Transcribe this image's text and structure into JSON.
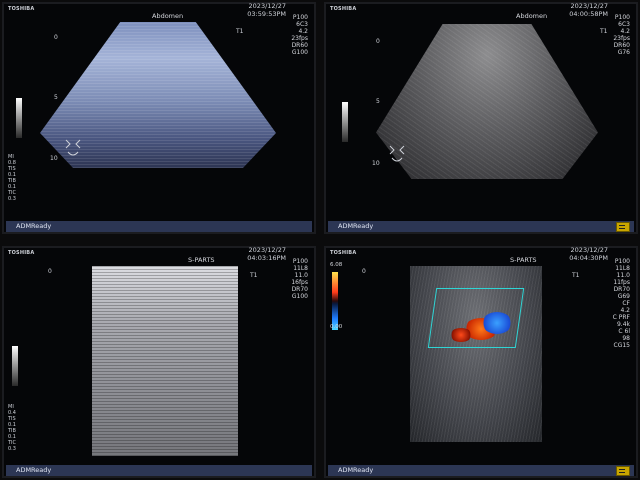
{
  "panels": [
    {
      "brand": "TOSHIBA",
      "date": "2023/12/27",
      "time": "03:59:53PM",
      "application": "Abdomen",
      "params": [
        "P100",
        "6C3",
        "4.2",
        "23fps",
        "DR60",
        "G100"
      ],
      "depth_top": "0",
      "depth_mid": "5",
      "depth_bottom": "10",
      "stats": [
        "MI",
        "0.8",
        "TIS",
        "0.1",
        "TIB",
        "0.1",
        "TIC",
        "0.3"
      ],
      "status": "ADMReady",
      "probe_mark": "T1"
    },
    {
      "brand": "TOSHIBA",
      "date": "2023/12/27",
      "time": "04:00:58PM",
      "application": "Abdomen",
      "params": [
        "P100",
        "6C3",
        "4.2",
        "23fps",
        "DR60",
        "G76"
      ],
      "depth_top": "0",
      "depth_mid": "5",
      "depth_bottom": "10",
      "status": "ADMReady",
      "probe_mark": "T1"
    },
    {
      "brand": "TOSHIBA",
      "date": "2023/12/27",
      "time": "04:03:16PM",
      "application": "S-PARTS",
      "params": [
        "P100",
        "11L8",
        "11.0",
        "16fps",
        "DR70",
        "G100"
      ],
      "depth_top": "0",
      "stats": [
        "MI",
        "0.4",
        "TIS",
        "0.1",
        "TIB",
        "0.1",
        "TIC",
        "0.3"
      ],
      "status": "ADMReady",
      "probe_mark": "T1"
    },
    {
      "brand": "TOSHIBA",
      "date": "2023/12/27",
      "time": "04:04:30PM",
      "application": "S-PARTS",
      "params": [
        "P100",
        "11L8",
        "11.0",
        "11fps",
        "DR70",
        "G69",
        "CF",
        "4.2",
        "C PRF",
        "9.4k",
        "C 6l",
        "98",
        "CG15"
      ],
      "depth_top": "0",
      "color_scale_top": "6.08",
      "color_scale_zero": "0.00",
      "status": "ADMReady",
      "probe_mark": "T1"
    }
  ],
  "colors": {
    "status_bar": "#2c3654",
    "freeze_icon": "#c9a600",
    "color_box": "#2fd5d5"
  }
}
